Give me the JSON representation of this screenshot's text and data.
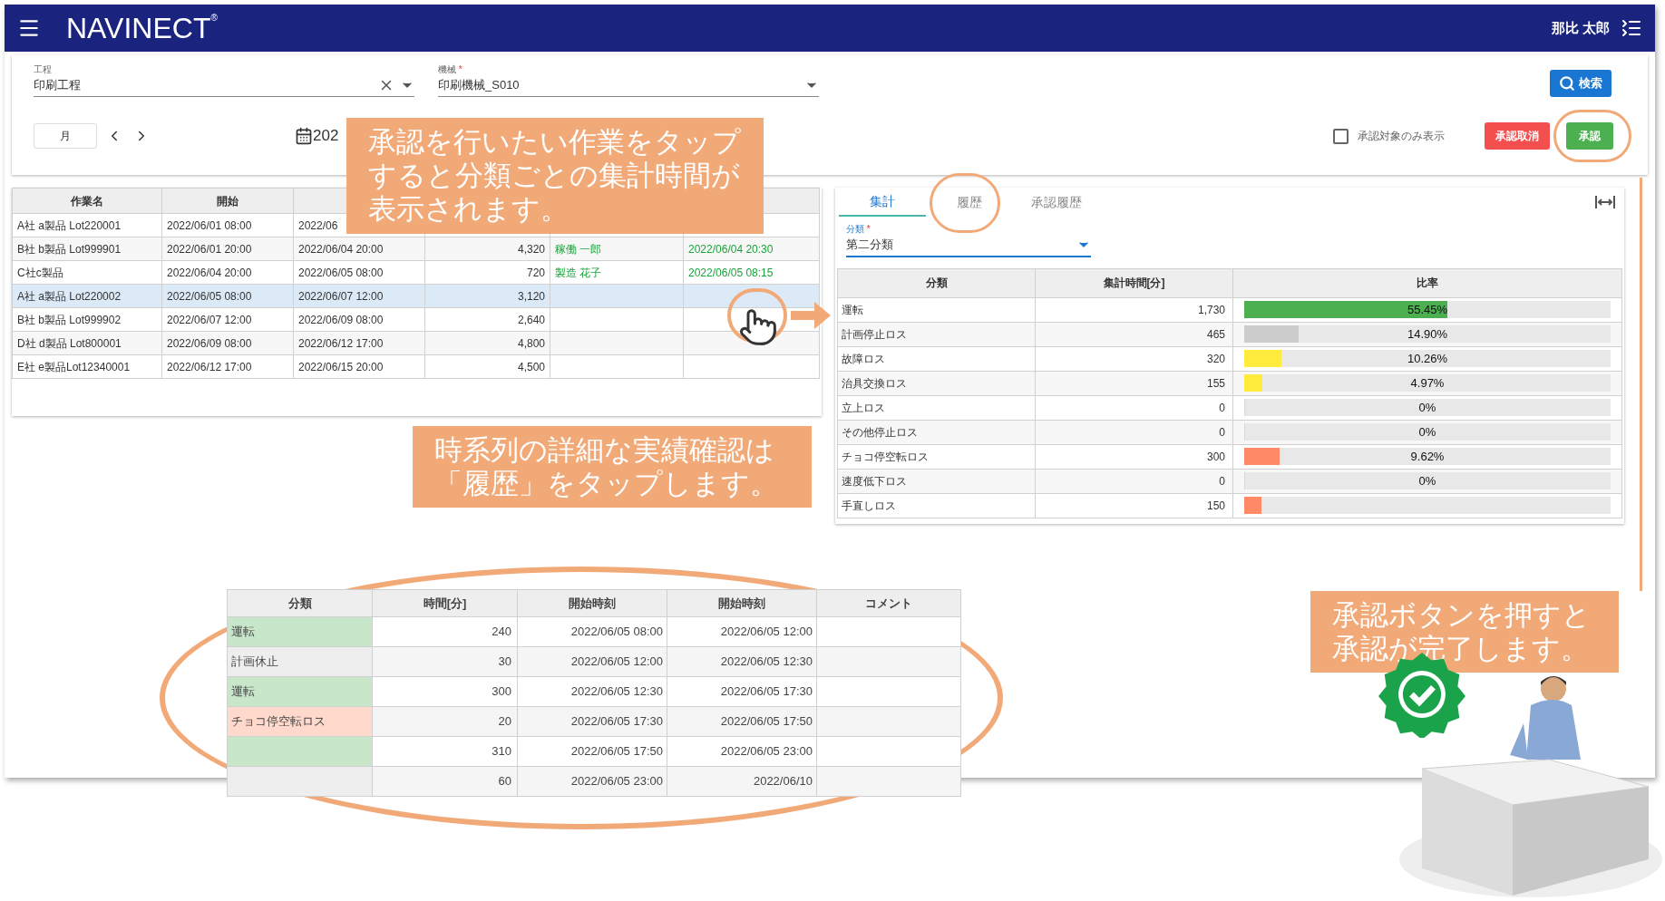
{
  "header": {
    "logo": "NAVINECT",
    "logo_mark": "®",
    "user": "那比 太郎"
  },
  "filters": {
    "process": {
      "label": "工程",
      "value": "印刷工程"
    },
    "machine": {
      "label": "機械",
      "required_mark": "*",
      "value": "印刷機械_S010"
    },
    "search_button": "検索",
    "period_button": "月",
    "date_text": "202",
    "approval_only": {
      "label": "承認対象のみ表示",
      "checked": false
    },
    "cancel_button": "承認取消",
    "approve_button": "承認"
  },
  "jobs": {
    "columns": [
      "作業名",
      "開始"
    ],
    "rows": [
      {
        "name": "A社 a製品 Lot220001",
        "start": "2022/06/01 08:00",
        "end": "2022/06",
        "selected": false
      },
      {
        "name": "B社 b製品 Lot999901",
        "start": "2022/06/01 20:00",
        "end": "2022/06/04 20:00",
        "quantity": "4,320",
        "worker": "稼働 一郎",
        "approved_at": "2022/06/04 20:30",
        "selected": false
      },
      {
        "name": "C社c製品",
        "start": "2022/06/04 20:00",
        "end": "2022/06/05 08:00",
        "quantity": "720",
        "worker": "製造 花子",
        "approved_at": "2022/06/05 08:15",
        "selected": false
      },
      {
        "name": "A社 a製品 Lot220002",
        "start": "2022/06/05 08:00",
        "end": "2022/06/07 12:00",
        "quantity": "3,120",
        "selected": true
      },
      {
        "name": "B社 b製品 Lot999902",
        "start": "2022/06/07 12:00",
        "end": "2022/06/09 08:00",
        "quantity": "2,640",
        "selected": false
      },
      {
        "name": "D社 d製品 Lot800001",
        "start": "2022/06/09 08:00",
        "end": "2022/06/12 17:00",
        "quantity": "4,800",
        "selected": false
      },
      {
        "name": "E社 e製品Lot12340001",
        "start": "2022/06/12 17:00",
        "end": "2022/06/15 20:00",
        "quantity": "4,500",
        "selected": false
      }
    ]
  },
  "summary": {
    "tabs": [
      {
        "label": "集計",
        "selected": true
      },
      {
        "label": "履歴",
        "selected": false
      },
      {
        "label": "承認履歴",
        "selected": false
      }
    ],
    "category_field": {
      "label": "分類",
      "required_mark": "*",
      "value": "第二分類"
    },
    "columns": [
      "分類",
      "集計時間[分]",
      "比率"
    ],
    "rows": [
      {
        "category": "運転",
        "minutes": "1,730",
        "ratio": "55.45%",
        "level": 0.5545,
        "color": "#4caf50"
      },
      {
        "category": "計画停止ロス",
        "minutes": "465",
        "ratio": "14.90%",
        "level": 0.149,
        "color": "#cccccc"
      },
      {
        "category": "故障ロス",
        "minutes": "320",
        "ratio": "10.26%",
        "level": 0.1026,
        "color": "#ffeb3b"
      },
      {
        "category": "治具交換ロス",
        "minutes": "155",
        "ratio": "4.97%",
        "level": 0.0497,
        "color": "#ffeb3b"
      },
      {
        "category": "立上ロス",
        "minutes": "0",
        "ratio": "0%",
        "level": 0
      },
      {
        "category": "その他停止ロス",
        "minutes": "0",
        "ratio": "0%",
        "level": 0
      },
      {
        "category": "チョコ停空転ロス",
        "minutes": "300",
        "ratio": "9.62%",
        "level": 0.0962,
        "color": "#ff8a65"
      },
      {
        "category": "速度低下ロス",
        "minutes": "0",
        "ratio": "0%",
        "level": 0
      },
      {
        "category": "手直しロス",
        "minutes": "150",
        "level": 0.0481,
        "color": "#ff8a65"
      }
    ]
  },
  "history": {
    "columns": [
      "分類",
      "時間[分]",
      "開始時刻",
      "開始時刻",
      "コメント"
    ],
    "rows": [
      {
        "category": "運転",
        "color": "#c8e6c9",
        "minutes": "240",
        "start": "2022/06/05 08:00",
        "end": "2022/06/05 12:00"
      },
      {
        "category": "計画休止",
        "color": "#eeeeee",
        "minutes": "30",
        "start": "2022/06/05 12:00",
        "end": "2022/06/05 12:30"
      },
      {
        "category": "運転",
        "color": "#c8e6c9",
        "minutes": "300",
        "start": "2022/06/05 12:30",
        "end": "2022/06/05 17:30"
      },
      {
        "category": "チョコ停空転ロス",
        "color": "#ffdacc",
        "minutes": "20",
        "start": "2022/06/05 17:30",
        "end": "2022/06/05 17:50"
      },
      {
        "color": "#c8e6c9",
        "minutes": "310",
        "start": "2022/06/05 17:50",
        "end": "2022/06/05 23:00"
      },
      {
        "color": "#eeeeee",
        "minutes": "60",
        "start": "2022/06/05 23:00",
        "end": "2022/06/10"
      }
    ]
  },
  "callouts": [
    "承認を行いたい作業をタップすると分類ごとの集計時間が表示されます。",
    "時系列の詳細な実績確認は「履歴」をタップします。",
    "承認ボタンを押すと承認が完了します。"
  ]
}
